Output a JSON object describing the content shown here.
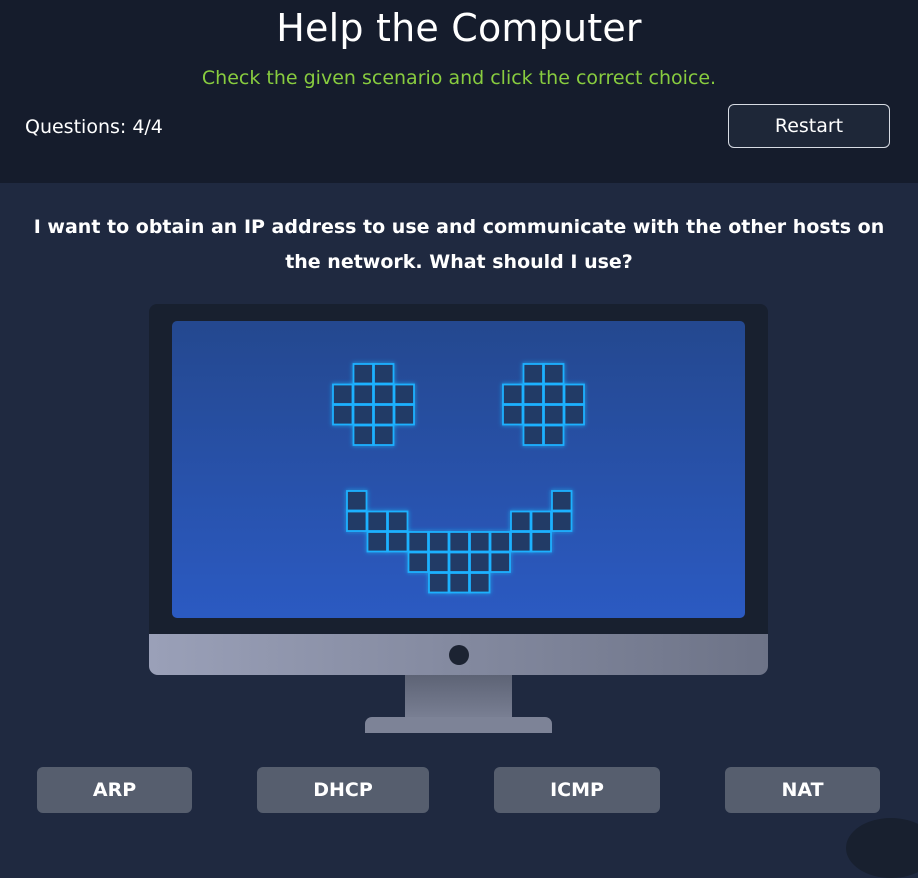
{
  "header": {
    "title": "Help the Computer",
    "subtitle": "Check the given scenario and click the correct choice.",
    "questions_label": "Questions: 4/4",
    "restart_label": "Restart"
  },
  "question": {
    "text": "I want to obtain an IP address to use and communicate with the other hosts on the network. What should I use?"
  },
  "choices": [
    {
      "label": "ARP"
    },
    {
      "label": "DHCP"
    },
    {
      "label": "ICMP"
    },
    {
      "label": "NAT"
    }
  ],
  "colors": {
    "accent_green": "#88cc3f",
    "screen_glow": "#1fa6e8",
    "button_bg": "#565e6e"
  }
}
